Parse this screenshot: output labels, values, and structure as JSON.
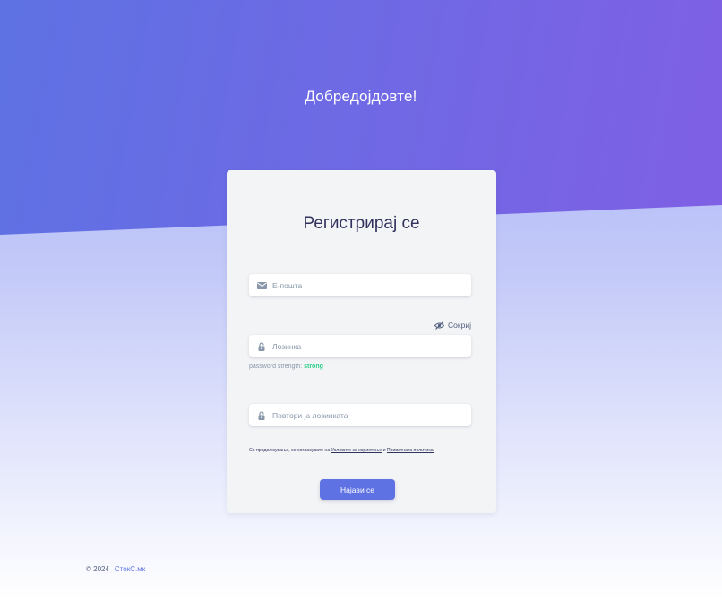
{
  "hero": {
    "welcome_text": "Добредојдовте!"
  },
  "register": {
    "title": "Регистрирај се",
    "email": {
      "placeholder": "Е-пошта",
      "value": ""
    },
    "password_toggle_label": "Сокриј",
    "password": {
      "placeholder": "Лозинка",
      "value": ""
    },
    "strength": {
      "label": "password strength:",
      "value": "strong"
    },
    "confirm_password": {
      "placeholder": "Повтори ја лозинката",
      "value": ""
    },
    "terms": {
      "prefix": "Со продолжување, се согласувате на",
      "terms_link": "Условите за користење",
      "conjunction": "и",
      "privacy_link": "Приватната политика."
    },
    "submit_label": "Најави се"
  },
  "footer": {
    "copyright": "© 2024",
    "brand_link": "СтокС.мк"
  },
  "colors": {
    "accent": "#5e72e4",
    "hero_gradient_start": "#5e72e4",
    "hero_gradient_end": "#825ee4",
    "strength_strong": "#2dce89"
  },
  "icons": {
    "email": "envelope-icon",
    "password": "lock-icon",
    "confirm_password": "lock-icon",
    "toggle": "eye-slash-icon"
  }
}
